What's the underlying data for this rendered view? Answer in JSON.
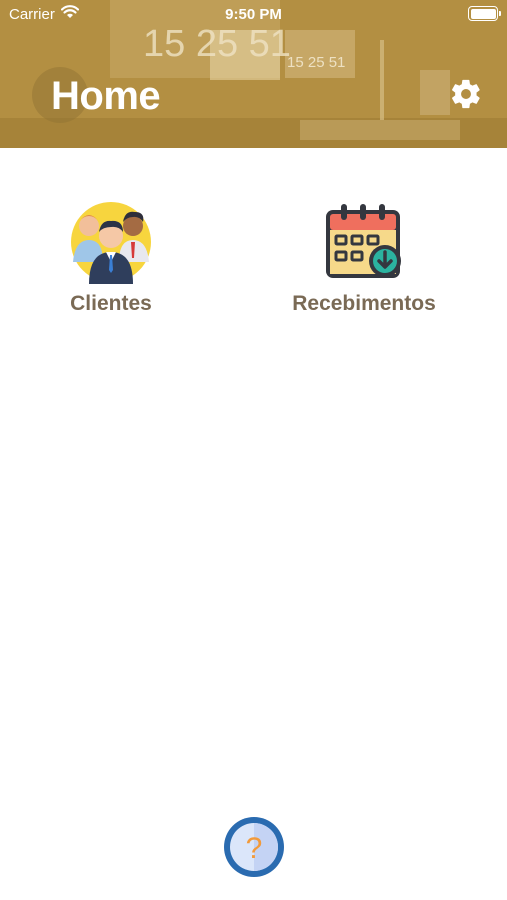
{
  "status_bar": {
    "carrier": "Carrier",
    "time": "9:50 PM"
  },
  "header": {
    "title": "Home",
    "background_clock_text": "15 25 51",
    "accent_color": "#b5924a",
    "settings_icon": "gear-icon"
  },
  "menu": {
    "items": [
      {
        "label": "Clientes",
        "icon": "people-group-icon"
      },
      {
        "label": "Recebimentos",
        "icon": "calendar-download-icon"
      }
    ]
  },
  "help": {
    "glyph": "?",
    "icon": "help-icon"
  }
}
